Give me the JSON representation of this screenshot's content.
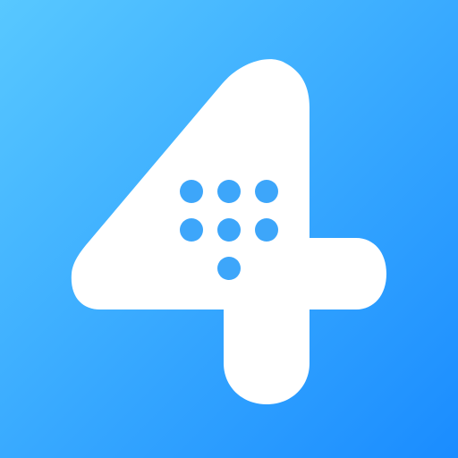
{
  "app_icon": {
    "icon_name": "digit-four-dialpad-icon",
    "colors": {
      "background_start": "#58C8FF",
      "background_end": "#1A8CFF",
      "glyph": "#FFFFFF",
      "keypad_dot": "#3DA6FA"
    },
    "keypad": {
      "rows": [
        3,
        3,
        1
      ]
    }
  }
}
